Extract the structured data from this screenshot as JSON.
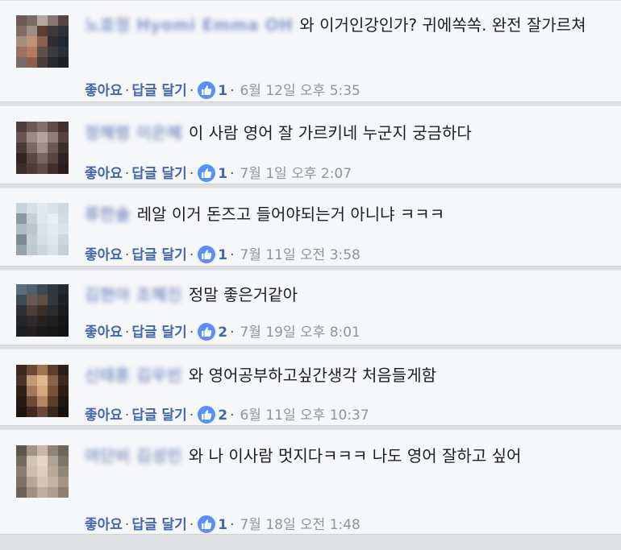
{
  "labels": {
    "like": "좋아요",
    "reply": "답글 달기",
    "sep": "·"
  },
  "comments": [
    {
      "name": "노효정 Hyomi Emma OH",
      "text": "와 이거인강인가? 귀에쏙쏙. 완전 잘가르쳐",
      "likes": "1",
      "time": "6월 12일 오후 5:35",
      "avatar_colors": [
        "#6b5a55",
        "#7c6c68",
        "#b6a7a1",
        "#8a7672",
        "#55473f",
        "#806c62",
        "#9f8e86",
        "#5a3e33",
        "#3f3a39",
        "#2d3336",
        "#a68e7d",
        "#c2917a",
        "#88604c",
        "#2b2f33",
        "#1f2a30",
        "#9c7060",
        "#b37a5e",
        "#60504a",
        "#3c3b3c",
        "#2a3035",
        "#7a6b68",
        "#8d5f4b",
        "#4a3e3b",
        "#272b2e",
        "#1d2225"
      ]
    },
    {
      "name": "정혜령 이은혜",
      "text": "이 사람 영어 잘 가르키네 누군지 궁금하다",
      "likes": "1",
      "time": "7월 1일 오후 2:07",
      "avatar_colors": [
        "#4d3f3e",
        "#6b5959",
        "#826f6d",
        "#5e4c4a",
        "#3e3231",
        "#6a5553",
        "#9c8783",
        "#b4a39e",
        "#8f7d79",
        "#55423f",
        "#4a3a38",
        "#7b6663",
        "#a28d89",
        "#6d5855",
        "#3c2f2d",
        "#2f2524",
        "#5a4745",
        "#7a6461",
        "#574542",
        "#2e2322",
        "#3a2d2c",
        "#4c3c3a",
        "#5f4c49",
        "#3f302f",
        "#2a1f1e"
      ]
    },
    {
      "name": "류한솔",
      "text": "레알 이거 돈즈고 들어야되는거 아니냐 ㅋㅋㅋ",
      "likes": "1",
      "time": "7월 11일 오전 3:58",
      "avatar_colors": [
        "#c8d4dc",
        "#d6e0e6",
        "#e3eaee",
        "#d9e2e8",
        "#cfd9e0",
        "#8a999f",
        "#c5d0d6",
        "#dfe7ec",
        "#e8eef1",
        "#d3dde3",
        "#aebcc3",
        "#b9c6cd",
        "#d8e1e6",
        "#e4ebee",
        "#dbe3e8",
        "#7e8c91",
        "#c2cdd3",
        "#d5dee3",
        "#e0e7eb",
        "#cdd7dd",
        "#94a3a9",
        "#bccad0",
        "#ccd6dc",
        "#d9e1e6",
        "#c6d1d7"
      ]
    },
    {
      "name": "김현아 조혜진",
      "text": "정말 좋은거같아",
      "likes": "2",
      "time": "7월 19일 오후 8:01",
      "avatar_colors": [
        "#5a6f80",
        "#4d6070",
        "#3d4a55",
        "#2e3840",
        "#22292f",
        "#3f4b55",
        "#6a5a4f",
        "#5e5046",
        "#33383d",
        "#1e2226",
        "#2b3137",
        "#4e3f36",
        "#3a302a",
        "#2a2b2d",
        "#1a1c1e",
        "#23272b",
        "#2e2a27",
        "#25221f",
        "#1f1f20",
        "#151617",
        "#1c1f22",
        "#222020",
        "#1b1a19",
        "#171718",
        "#121314"
      ]
    },
    {
      "name": "신태훈 김우빈",
      "text": "와 영어공부하고싶간생각 처음들게함",
      "likes": "2",
      "time": "6월 11일 오후 10:37",
      "avatar_colors": [
        "#3a2a22",
        "#6b4a33",
        "#a0764f",
        "#5c3f2b",
        "#2a1f19",
        "#4a3428",
        "#c29a72",
        "#e0b890",
        "#8c6246",
        "#3b2a20",
        "#2e2119",
        "#a3785a",
        "#d6a880",
        "#7a5238",
        "#2c1f17",
        "#251a14",
        "#6e4a35",
        "#b38763",
        "#5a3d2a",
        "#201612",
        "#1c1410",
        "#3d2a1f",
        "#6a4a36",
        "#3a281e",
        "#18110d"
      ]
    },
    {
      "name": "여단비 김성민",
      "text": "와 나 이사람 멋지다ㅋㅋㅋ 나도 영어 잘하고 싶어",
      "likes": "1",
      "time": "7월 18일 오전 1:48",
      "avatar_colors": [
        "#5c5650",
        "#a09488",
        "#c9b8aa",
        "#8e8378",
        "#6e655d",
        "#736a62",
        "#d4c2b4",
        "#e6d4c6",
        "#b2a295",
        "#7f7469",
        "#8a7e73",
        "#cfbcad",
        "#e0cdbe",
        "#bba899",
        "#928579",
        "#7e7267",
        "#b9a596",
        "#d8c4b5",
        "#c7b3a3",
        "#a69587",
        "#6c625a",
        "#9f8f82",
        "#bfad9e",
        "#b09e90",
        "#8d7f73"
      ]
    }
  ]
}
